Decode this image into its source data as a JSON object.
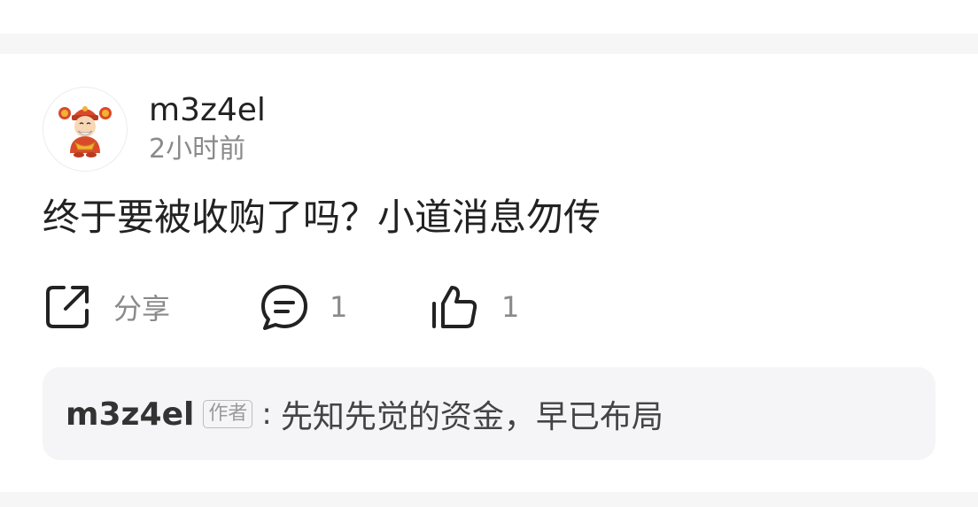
{
  "post": {
    "author": "m3z4el",
    "time": "2小时前",
    "content": "终于要被收购了吗？小道消息勿传"
  },
  "actions": {
    "share_label": "分享",
    "comment_count": "1",
    "like_count": "1"
  },
  "reply": {
    "author": "m3z4el",
    "badge": "作者",
    "separator": ":",
    "text": "先知先觉的资金，早已布局"
  },
  "icons": {
    "share": "share-icon",
    "comment": "comment-icon",
    "like": "thumbs-up-icon",
    "avatar": "fortune-god-avatar"
  },
  "colors": {
    "primary_text": "#222222",
    "secondary_text": "#8a8a8a",
    "divider_band": "#f6f6f6",
    "reply_background": "#f5f5f7"
  }
}
